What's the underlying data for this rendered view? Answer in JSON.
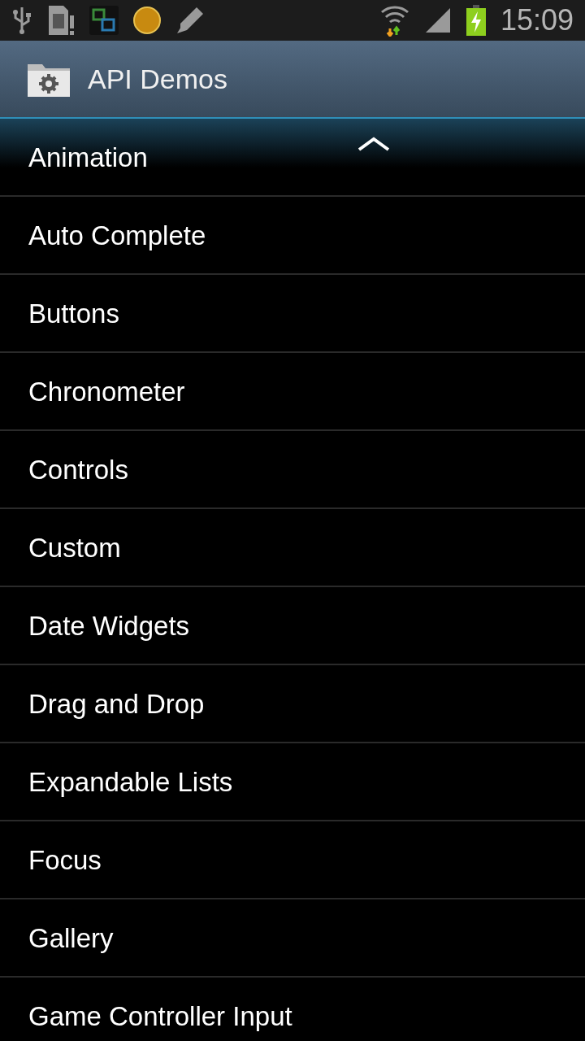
{
  "status_bar": {
    "time": "15:09"
  },
  "action_bar": {
    "title": "API Demos"
  },
  "list": {
    "items": [
      {
        "label": "Animation"
      },
      {
        "label": "Auto Complete"
      },
      {
        "label": "Buttons"
      },
      {
        "label": "Chronometer"
      },
      {
        "label": "Controls"
      },
      {
        "label": "Custom"
      },
      {
        "label": "Date Widgets"
      },
      {
        "label": "Drag and Drop"
      },
      {
        "label": "Expandable Lists"
      },
      {
        "label": "Focus"
      },
      {
        "label": "Gallery"
      },
      {
        "label": "Game Controller Input"
      }
    ]
  }
}
